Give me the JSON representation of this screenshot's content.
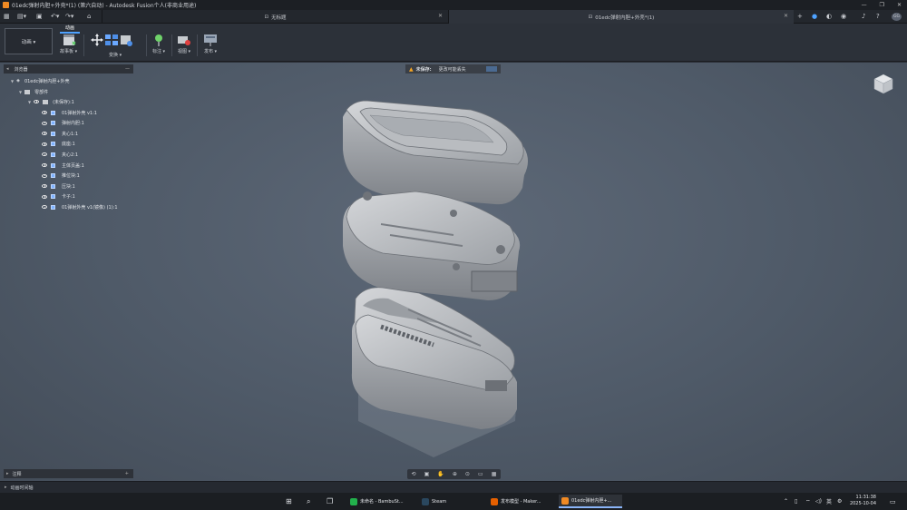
{
  "window": {
    "title": "01edc弹射内胆+外壳*(1) (第六自动) - Autodesk Fusion个人(非商业用途)",
    "controls": [
      "—",
      "❐",
      "✕"
    ]
  },
  "tabs": [
    {
      "label": "无标题",
      "active": false
    },
    {
      "label": "01edc弹射内胆+外壳*(1)",
      "active": true
    }
  ],
  "user_initials": "GG",
  "toolbar": {
    "workspace_label": "动画 ▾",
    "active_tab": "动画",
    "tools": [
      {
        "label": "故事板 ▾"
      },
      {
        "label": "变换 ▾"
      },
      {
        "label": "标注 ▾"
      },
      {
        "label": "视图 ▾"
      },
      {
        "label": "发布 ▾"
      }
    ]
  },
  "browser": {
    "title": "浏览器",
    "root": "01edc弹射内胆+外壳",
    "components_folder": "零部件",
    "scene": "(未保存):1",
    "items": [
      "01弹射外壳 v1:1",
      "弹射内胆:1",
      "夹心1:1",
      "底座:1",
      "夹心2:1",
      "主体页盖:1",
      "推位块:1",
      "压块:1",
      "卡子:1",
      "01弹射外壳 v1(镜像) (1):1"
    ]
  },
  "warning": {
    "title": "未保存:",
    "message": "更改可能丢失"
  },
  "notes": {
    "title": "注释"
  },
  "timeline": {
    "label": "动画时间轴"
  },
  "taskbar": {
    "apps": [
      {
        "label": "未命名 - BambuSt...",
        "color": "#22b14c",
        "active": false
      },
      {
        "label": "Steam",
        "color": "#2a475e",
        "active": false
      },
      {
        "label": "发布模型 - Maker...",
        "color": "#e66000",
        "active": false
      },
      {
        "label": "01edc弹射内胆+...",
        "color": "#f08a24",
        "active": true
      }
    ],
    "tray_lang": "英",
    "time": "11:31:38",
    "date": "2025-10-04"
  },
  "colors": {
    "accent": "#4ea2ff",
    "fusion_orange": "#f08a24",
    "warning": "#f5a524",
    "viewport": "#55606e"
  }
}
